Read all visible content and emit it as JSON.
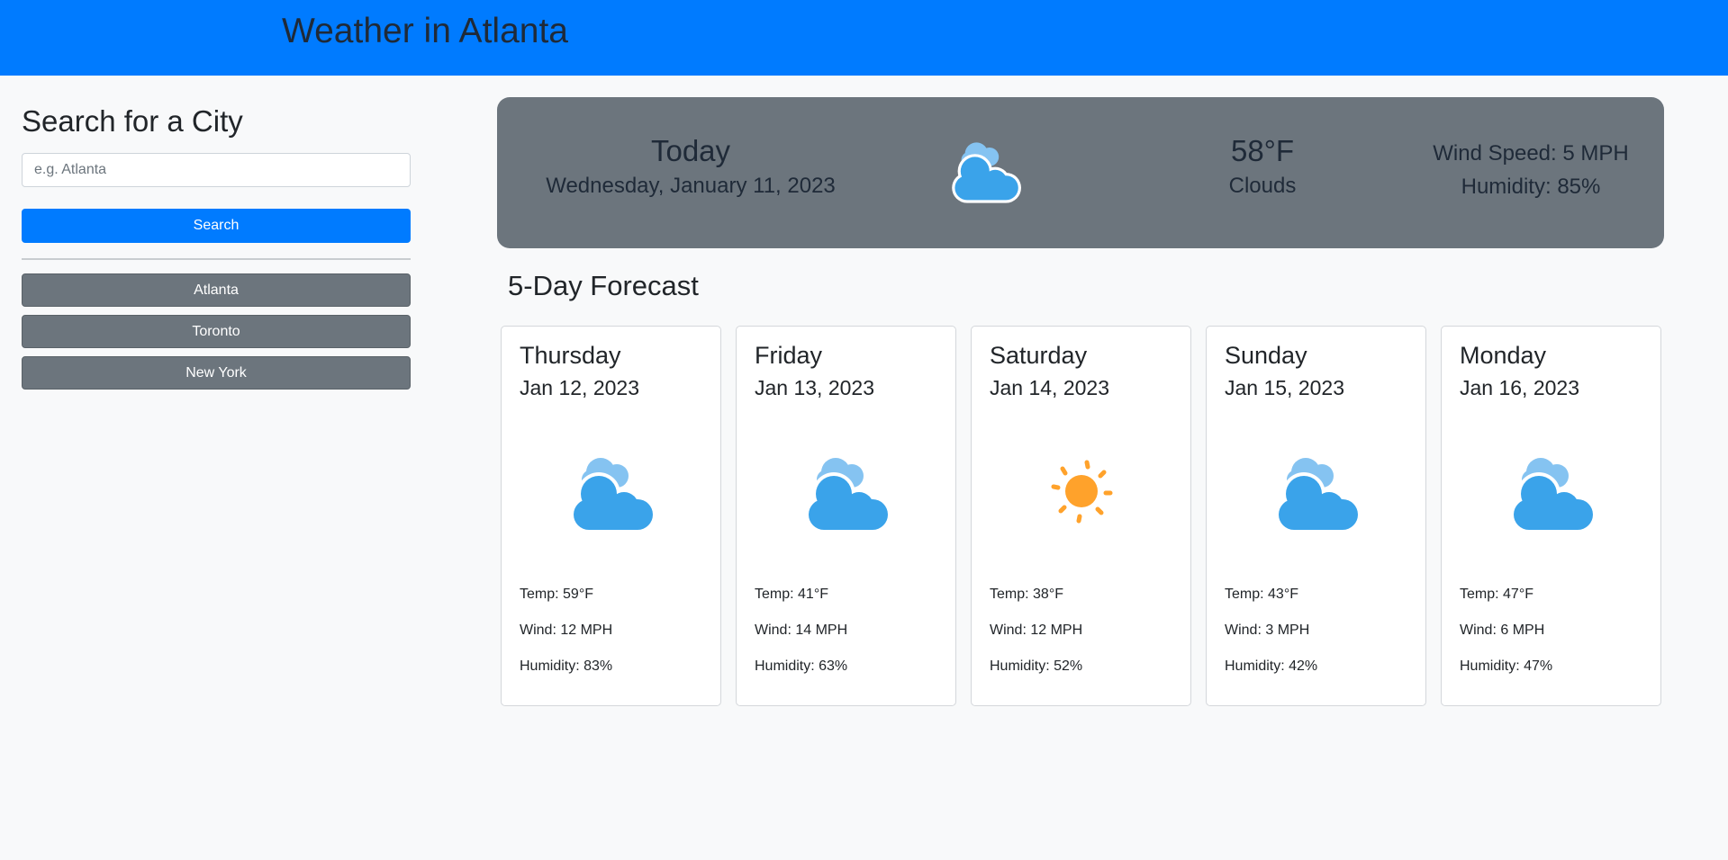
{
  "header": {
    "title": "Weather in Atlanta"
  },
  "sidebar": {
    "heading": "Search for a City",
    "search_placeholder": "e.g. Atlanta",
    "search_button": "Search",
    "history": [
      "Atlanta",
      "Toronto",
      "New York"
    ]
  },
  "today": {
    "label": "Today",
    "date": "Wednesday, January 11, 2023",
    "icon": "clouds-icon",
    "temp": "58°F",
    "condition": "Clouds",
    "wind": "Wind Speed: 5 MPH",
    "humidity": "Humidity: 85%"
  },
  "forecast": {
    "title": "5-Day Forecast",
    "days": [
      {
        "day": "Thursday",
        "date": "Jan 12, 2023",
        "icon": "clouds-icon",
        "temp": "Temp: 59°F",
        "wind": "Wind: 12 MPH",
        "humidity": "Humidity: 83%"
      },
      {
        "day": "Friday",
        "date": "Jan 13, 2023",
        "icon": "clouds-icon",
        "temp": "Temp: 41°F",
        "wind": "Wind: 14 MPH",
        "humidity": "Humidity: 63%"
      },
      {
        "day": "Saturday",
        "date": "Jan 14, 2023",
        "icon": "sun-icon",
        "temp": "Temp: 38°F",
        "wind": "Wind: 12 MPH",
        "humidity": "Humidity: 52%"
      },
      {
        "day": "Sunday",
        "date": "Jan 15, 2023",
        "icon": "clouds-icon",
        "temp": "Temp: 43°F",
        "wind": "Wind: 3 MPH",
        "humidity": "Humidity: 42%"
      },
      {
        "day": "Monday",
        "date": "Jan 16, 2023",
        "icon": "clouds-icon",
        "temp": "Temp: 47°F",
        "wind": "Wind: 6 MPH",
        "humidity": "Humidity: 47%"
      }
    ]
  },
  "colors": {
    "primary": "#007bff",
    "secondary": "#6c757d",
    "cloud": "#3aa3ea",
    "sun": "#ffa22b"
  }
}
